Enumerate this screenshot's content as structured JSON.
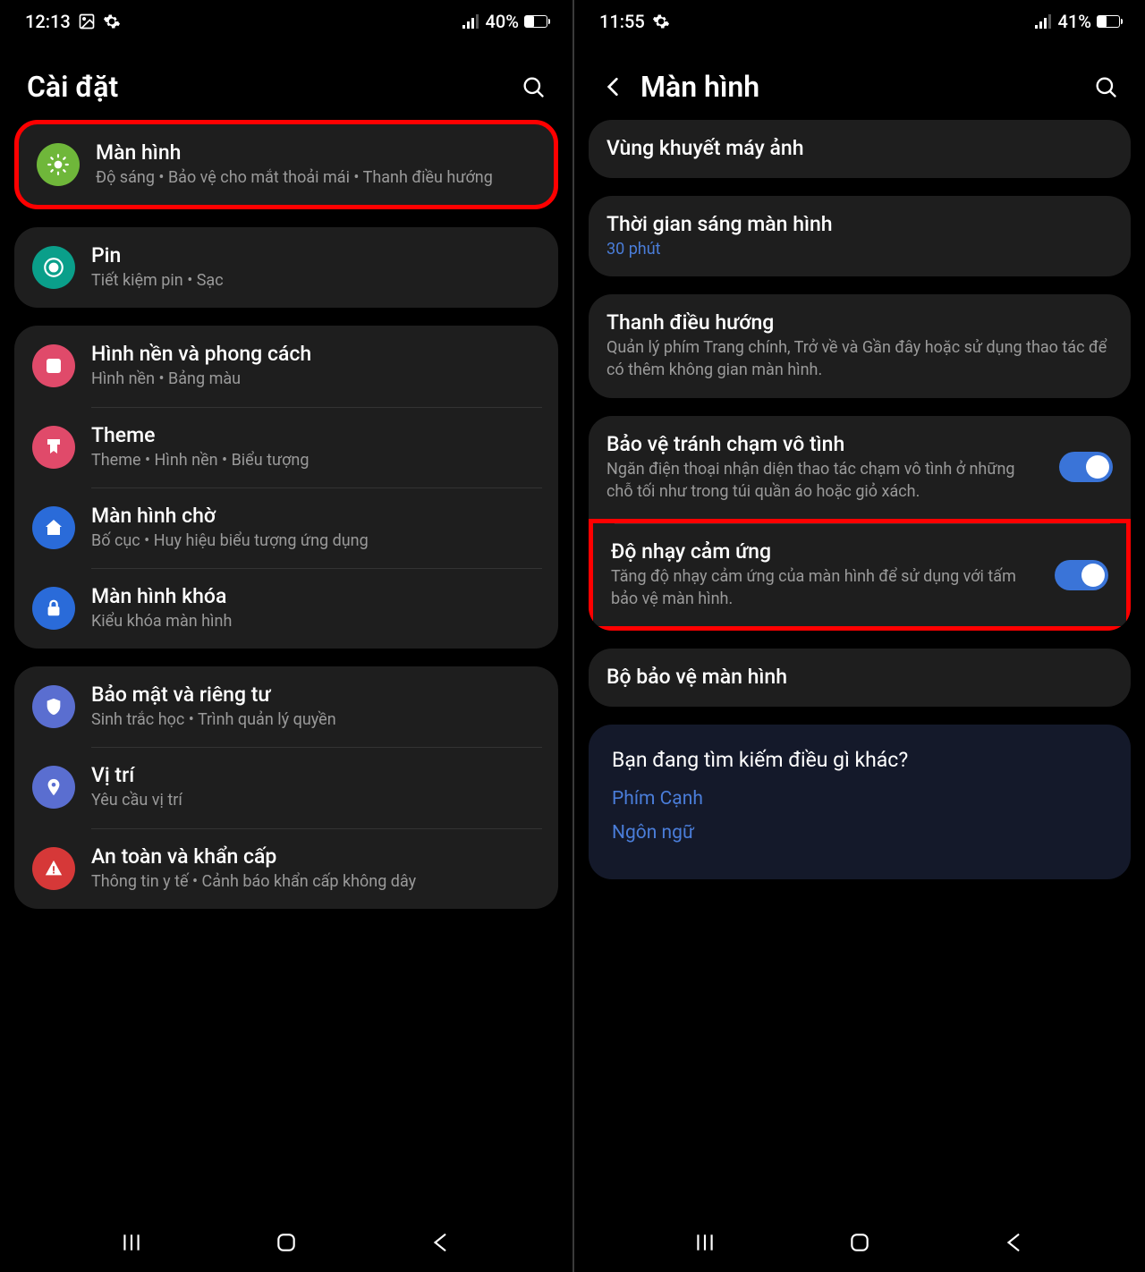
{
  "left": {
    "status": {
      "time": "12:13",
      "battery": "40%"
    },
    "header": {
      "title": "Cài đặt"
    },
    "group1": [
      {
        "icon": "brightness",
        "bg": "#6fb73a",
        "title": "Màn hình",
        "sub": "Độ sáng  •  Bảo vệ cho mắt thoải mái  •  Thanh điều hướng",
        "highlight": true
      }
    ],
    "group1b": [
      {
        "icon": "battery-circle",
        "bg": "#0a9f8a",
        "title": "Pin",
        "sub": "Tiết kiệm pin  •  Sạc"
      }
    ],
    "group2": [
      {
        "icon": "wallpaper",
        "bg": "#e04a6a",
        "title": "Hình nền và phong cách",
        "sub": "Hình nền  •  Bảng màu"
      },
      {
        "icon": "theme",
        "bg": "#e04a6a",
        "title": "Theme",
        "sub": "Theme  •  Hình nền  •  Biểu tượng"
      },
      {
        "icon": "home",
        "bg": "#2a6bd9",
        "title": "Màn hình chờ",
        "sub": "Bố cục  •  Huy hiệu biểu tượng ứng dụng"
      },
      {
        "icon": "lock",
        "bg": "#2a6bd9",
        "title": "Màn hình khóa",
        "sub": "Kiểu khóa màn hình"
      }
    ],
    "group3": [
      {
        "icon": "shield",
        "bg": "#5a6ed0",
        "title": "Bảo mật và riêng tư",
        "sub": "Sinh trắc học  •  Trình quản lý quyền"
      },
      {
        "icon": "location",
        "bg": "#5a6ed0",
        "title": "Vị trí",
        "sub": "Yêu cầu vị trí"
      },
      {
        "icon": "alert",
        "bg": "#d63838",
        "title": "An toàn và khẩn cấp",
        "sub": "Thông tin y tế  •  Cảnh báo khẩn cấp không dây"
      }
    ]
  },
  "right": {
    "status": {
      "time": "11:55",
      "battery": "41%"
    },
    "header": {
      "title": "Màn hình"
    },
    "groupA": [
      {
        "title": "Vùng khuyết máy ảnh"
      }
    ],
    "groupB": [
      {
        "title": "Thời gian sáng màn hình",
        "sub": "30 phút",
        "subLink": true
      }
    ],
    "groupC": [
      {
        "title": "Thanh điều hướng",
        "sub": "Quản lý phím Trang chính, Trở về và Gần đây hoặc sử dụng thao tác để có thêm không gian màn hình."
      }
    ],
    "groupD": [
      {
        "title": "Bảo vệ tránh chạm vô tình",
        "sub": "Ngăn điện thoại nhận diện thao tác chạm vô tình ở những chỗ tối như trong túi quần áo hoặc giỏ xách.",
        "toggle": true
      },
      {
        "title": "Độ nhạy cảm ứng",
        "sub": "Tăng độ nhạy cảm ứng của màn hình để sử dụng với tấm bảo vệ màn hình.",
        "toggle": true,
        "highlight": true
      }
    ],
    "groupE": [
      {
        "title": "Bộ bảo vệ màn hình"
      }
    ],
    "lookfor": {
      "title": "Bạn đang tìm kiếm điều gì khác?",
      "links": [
        "Phím Cạnh",
        "Ngôn ngữ"
      ]
    }
  }
}
